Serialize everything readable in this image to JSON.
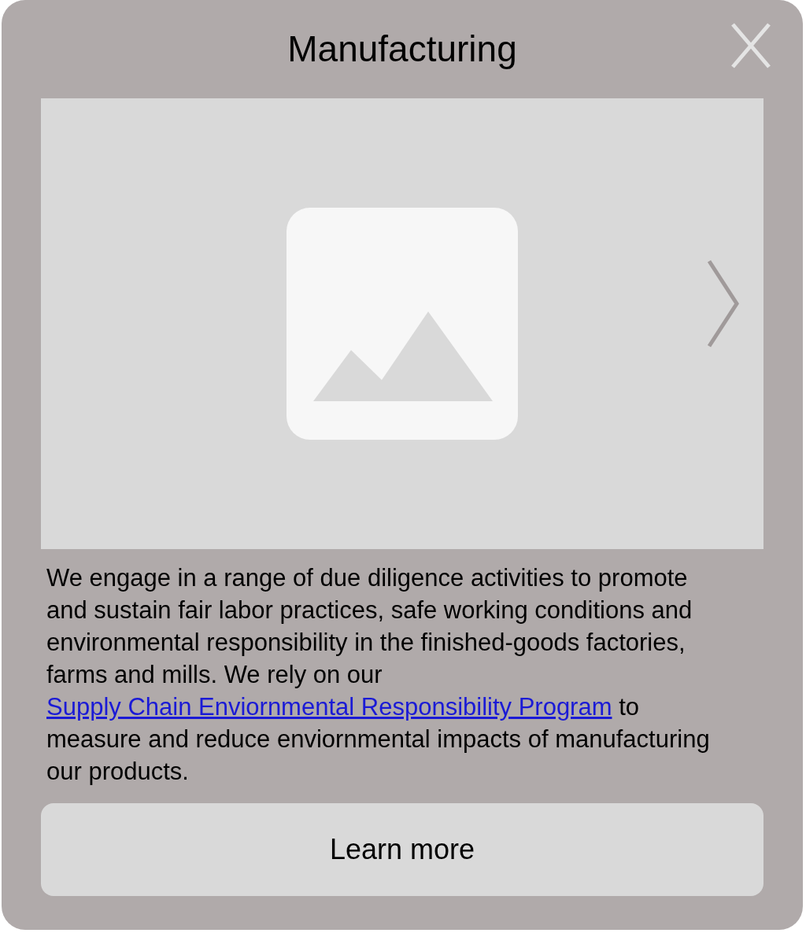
{
  "dialog": {
    "title": "Manufacturing",
    "description": {
      "before": "We engage in a range of due diligence activities to promote and sustain fair labor practices, safe working conditions and environmental responsibility in the finished-goods factories, farms and mills. We rely on our",
      "link": "Supply Chain Enviornmental Responsibility Program",
      "after": "to measure and reduce enviornmental impacts of manufacturing our products."
    },
    "button": "Learn more"
  }
}
